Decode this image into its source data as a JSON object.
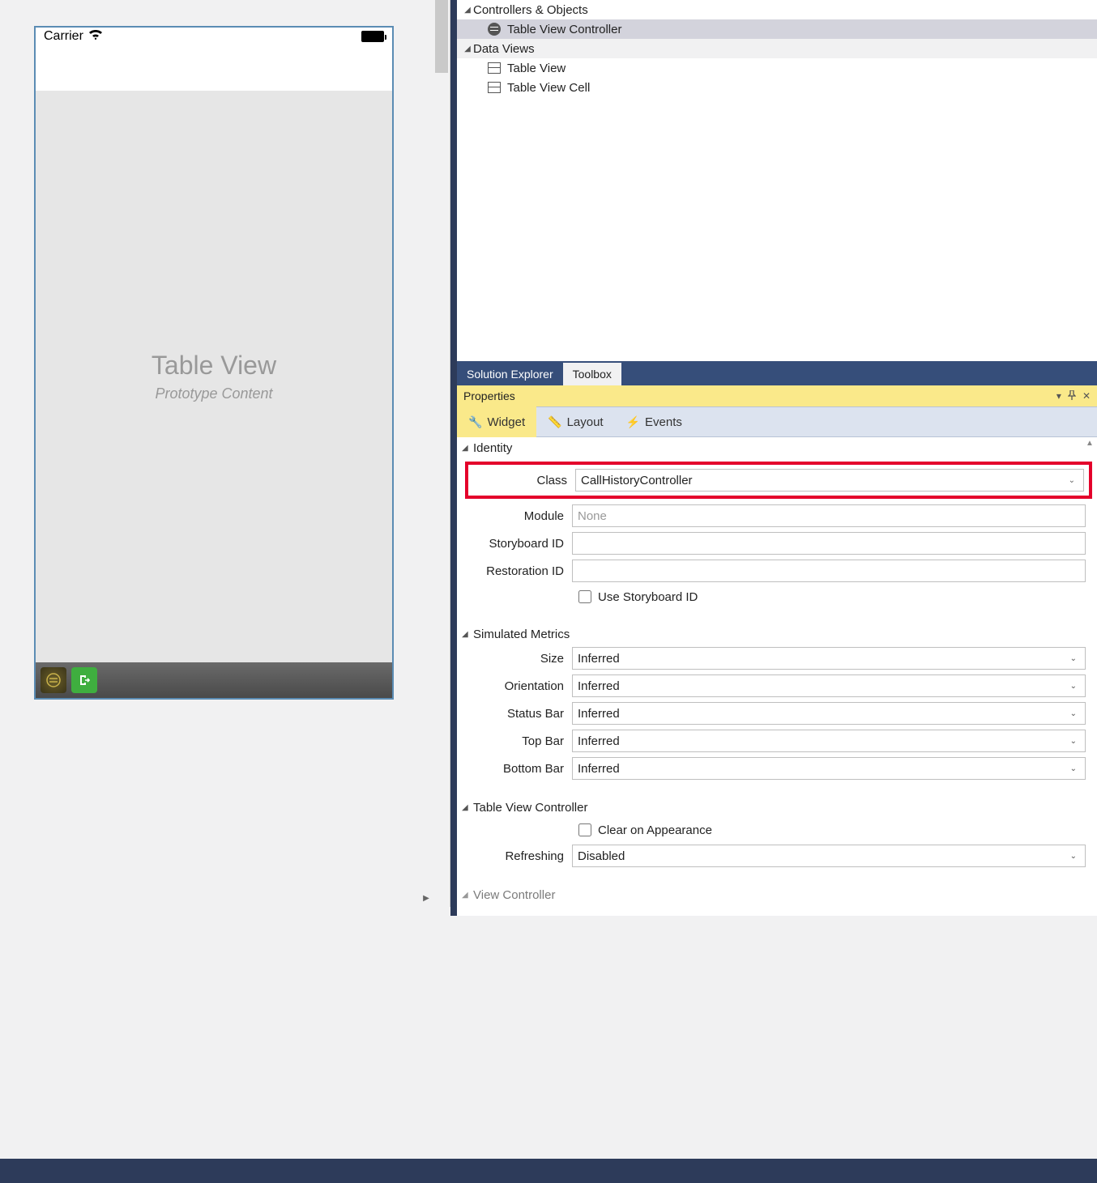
{
  "canvas": {
    "carrier": "Carrier",
    "table_view_title": "Table View",
    "table_view_subtitle": "Prototype Content"
  },
  "outline": {
    "group1": "Controllers & Objects",
    "item1": "Table View Controller",
    "group2": "Data Views",
    "item2": "Table View",
    "item3": "Table View Cell"
  },
  "tabs": {
    "solution_explorer": "Solution Explorer",
    "toolbox": "Toolbox"
  },
  "properties": {
    "title": "Properties",
    "subtabs": {
      "widget": "Widget",
      "layout": "Layout",
      "events": "Events"
    },
    "identity": {
      "header": "Identity",
      "class_label": "Class",
      "class_value": "CallHistoryController",
      "module_label": "Module",
      "module_placeholder": "None",
      "storyboard_id_label": "Storyboard ID",
      "storyboard_id_value": "",
      "restoration_id_label": "Restoration ID",
      "restoration_id_value": "",
      "use_storyboard_id_label": "Use Storyboard ID"
    },
    "simulated_metrics": {
      "header": "Simulated Metrics",
      "size_label": "Size",
      "size_value": "Inferred",
      "orientation_label": "Orientation",
      "orientation_value": "Inferred",
      "status_bar_label": "Status Bar",
      "status_bar_value": "Inferred",
      "top_bar_label": "Top Bar",
      "top_bar_value": "Inferred",
      "bottom_bar_label": "Bottom Bar",
      "bottom_bar_value": "Inferred"
    },
    "tvc": {
      "header": "Table View Controller",
      "clear_label": "Clear on Appearance",
      "refreshing_label": "Refreshing",
      "refreshing_value": "Disabled"
    },
    "vc": {
      "header": "View Controller"
    }
  }
}
